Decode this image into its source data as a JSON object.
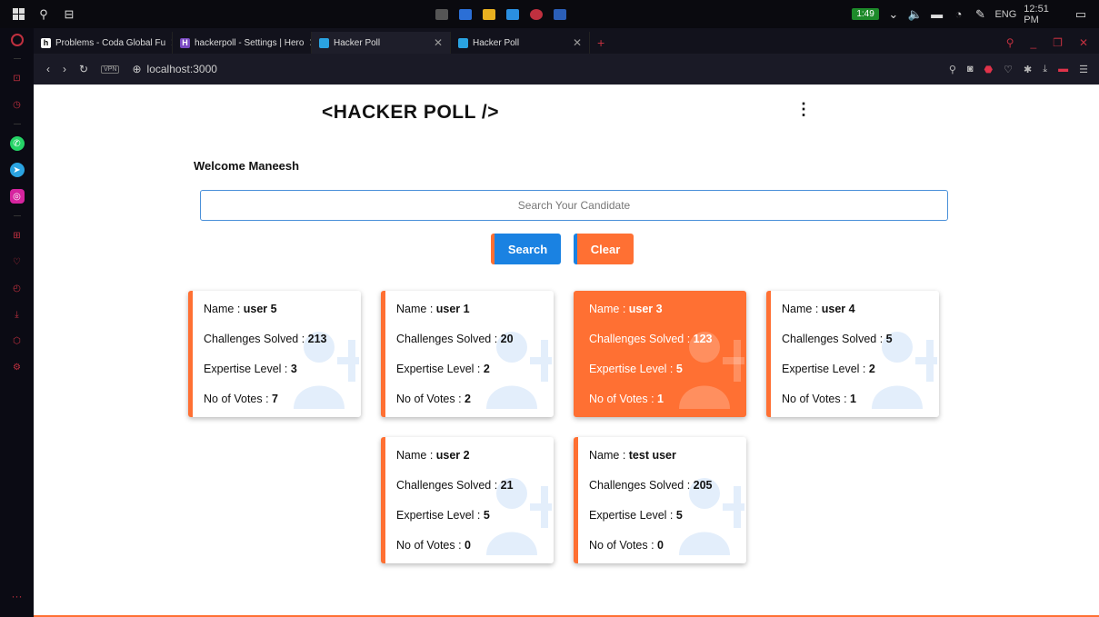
{
  "taskbar": {
    "battery": "1:49",
    "language": "ENG",
    "time": "12:51 PM"
  },
  "tabs": [
    {
      "title": "Problems - Coda Global Fu",
      "favicon_color": "#ffffff",
      "favicon_text": "h",
      "active": false
    },
    {
      "title": "hackerpoll - Settings | Hero",
      "favicon_color": "#7a4ac2",
      "favicon_text": "H",
      "active": false
    },
    {
      "title": "Hacker Poll",
      "favicon_color": "#2aa3e1",
      "favicon_text": "",
      "active": true
    },
    {
      "title": "Hacker Poll",
      "favicon_color": "#2aa3e1",
      "favicon_text": "",
      "active": false
    }
  ],
  "address": {
    "vpn_label": "VPN",
    "url": "localhost:3000"
  },
  "page": {
    "title": "<HACKER POLL />",
    "menu_icon": "kebab-menu-icon",
    "welcome": "Welcome Maneesh",
    "search_placeholder": "Search Your Candidate",
    "search_label": "Search",
    "clear_label": "Clear",
    "accent_orange": "#ff7033",
    "accent_blue": "#1a82e2"
  },
  "labels": {
    "name": "Name : ",
    "challenges": "Challenges Solved : ",
    "expertise": "Expertise Level : ",
    "votes": "No of Votes : "
  },
  "candidates": [
    {
      "name": "user 5",
      "challenges": "213",
      "expertise": "3",
      "votes": "7",
      "highlighted": false
    },
    {
      "name": "user 1",
      "challenges": "20",
      "expertise": "2",
      "votes": "2",
      "highlighted": false
    },
    {
      "name": "user 3",
      "challenges": "123",
      "expertise": "5",
      "votes": "1",
      "highlighted": true
    },
    {
      "name": "user 4",
      "challenges": "5",
      "expertise": "2",
      "votes": "1",
      "highlighted": false
    },
    {
      "name": "user 2",
      "challenges": "21",
      "expertise": "5",
      "votes": "0",
      "highlighted": false
    },
    {
      "name": "test user",
      "challenges": "205",
      "expertise": "5",
      "votes": "0",
      "highlighted": false
    }
  ]
}
